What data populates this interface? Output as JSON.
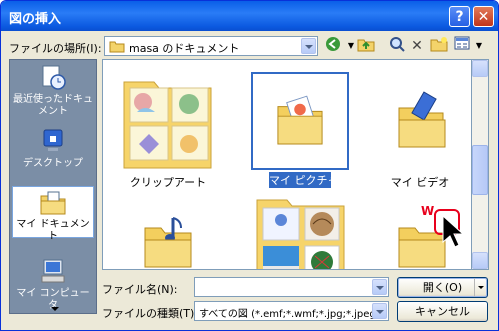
{
  "window": {
    "title": "図の挿入",
    "help": "?",
    "close": "✕"
  },
  "location": {
    "label": "ファイルの場所(I):",
    "value": "masa のドキュメント"
  },
  "places": [
    {
      "label": "最近使ったドキュメント",
      "icon": "recent-documents-icon"
    },
    {
      "label": "デスクトップ",
      "icon": "desktop-icon"
    },
    {
      "label": "マイ ドキュメント",
      "icon": "my-documents-icon",
      "selected": true
    },
    {
      "label": "マイ コンピュータ",
      "icon": "my-computer-icon"
    }
  ],
  "files": [
    {
      "name": "クリップアート",
      "icon": "clipart-folder-icon"
    },
    {
      "name": "マイ ピクチャ",
      "icon": "my-pictures-folder-icon",
      "selected": true
    },
    {
      "name": "マイ ビデオ",
      "icon": "my-videos-folder-icon"
    },
    {
      "name": "",
      "icon": "music-folder-icon"
    },
    {
      "name": "",
      "icon": "picture-folder-icon"
    },
    {
      "name": "",
      "icon": "folder-icon"
    }
  ],
  "filename": {
    "label": "ファイル名(N):",
    "value": ""
  },
  "filetype": {
    "label": "ファイルの種類(T):",
    "value": "すべての図 (*.emf;*.wmf;*.jpg;*.jpeg;"
  },
  "buttons": {
    "open": "開く(O)",
    "cancel": "キャンセル"
  },
  "overlay": {
    "marker": "W"
  },
  "colors": {
    "titlebar": "#0a5fe8",
    "selection": "#316ac5",
    "places_bg": "#7b8ea6",
    "marker": "#e8001c"
  }
}
